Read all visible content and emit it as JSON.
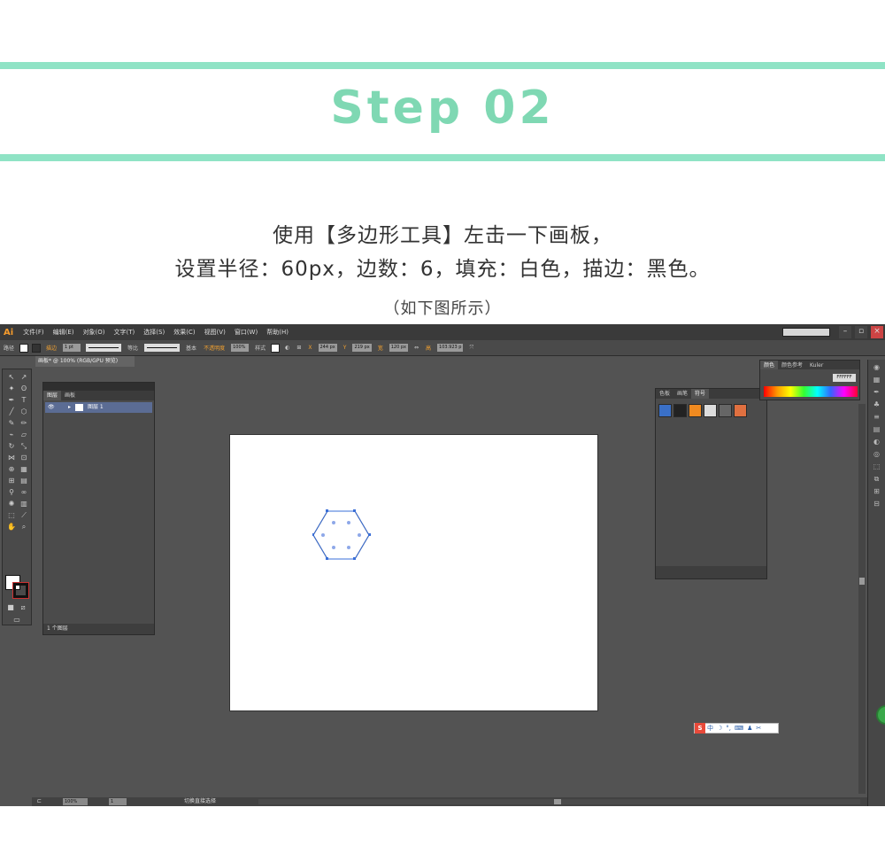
{
  "header": {
    "title": "Step 02"
  },
  "instructions": {
    "line1": "使用【多边形工具】左击一下画板，",
    "line2": "设置半径：60px，边数：6，填充：白色，描边：黑色。",
    "note": "（如下图所示）"
  },
  "app": {
    "logo": "Ai",
    "menu": [
      "文件(F)",
      "编辑(E)",
      "对象(O)",
      "文字(T)",
      "选择(S)",
      "效果(C)",
      "视图(V)",
      "窗口(W)",
      "帮助(H)"
    ],
    "control_bar": {
      "object_label": "路径",
      "stroke_label": "描边",
      "stroke_weight": "1 pt",
      "profile_label": "等比",
      "brush_label": "基本",
      "opacity_label": "不透明度",
      "opacity_value": "100%",
      "style_label": "样式",
      "x_label": "X",
      "x_value": "244 px",
      "y_label": "Y",
      "y_value": "219 px",
      "w_label": "宽",
      "w_value": "120 px",
      "h_label": "高",
      "h_value": "103.923 p"
    },
    "document_tab": "画板* @ 100% (RGB/GPU 预览)",
    "layers_panel": {
      "tabs": [
        "图层",
        "画板"
      ],
      "layer_name": "图层 1",
      "footer": "1 个图层"
    },
    "symbols_panel": {
      "tabs": [
        "色板",
        "画笔",
        "符号"
      ]
    },
    "color_panel": {
      "tabs": [
        "颜色",
        "颜色参考",
        "Kuler"
      ],
      "hex": "FFFFFF"
    },
    "status": {
      "zoom": "100%",
      "page": "1",
      "tool": "切换直接选择"
    },
    "ime": {
      "icon": "S",
      "label": "中"
    },
    "colors": {
      "accent_band": "#8fe3c5",
      "title_color": "#7fd8b3",
      "selection_blue": "#3a6fd8"
    }
  }
}
